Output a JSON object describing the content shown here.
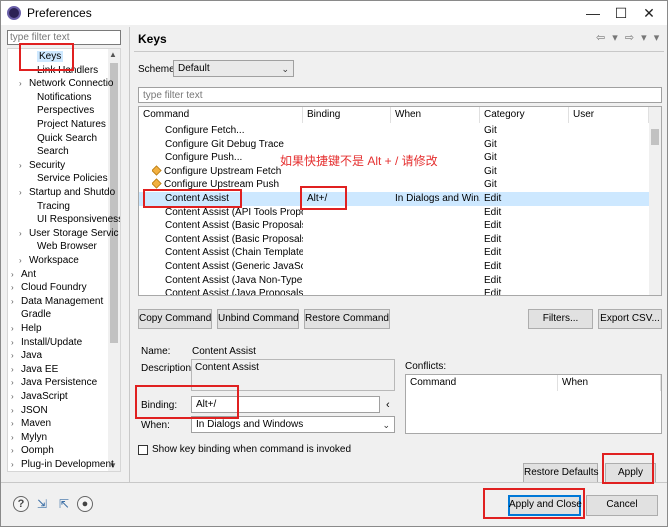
{
  "window": {
    "title": "Preferences",
    "minimize": "—",
    "maximize": "☐",
    "close": "✕"
  },
  "sidebar": {
    "filter_placeholder": "type filter text",
    "items": [
      {
        "label": "Keys",
        "indent": 2,
        "arrow": "",
        "selected": true
      },
      {
        "label": "Link Handlers",
        "indent": 2,
        "arrow": ""
      },
      {
        "label": "Network Connectio",
        "indent": 1,
        "arrow": "›"
      },
      {
        "label": "Notifications",
        "indent": 2,
        "arrow": ""
      },
      {
        "label": "Perspectives",
        "indent": 2,
        "arrow": ""
      },
      {
        "label": "Project Natures",
        "indent": 2,
        "arrow": ""
      },
      {
        "label": "Quick Search",
        "indent": 2,
        "arrow": ""
      },
      {
        "label": "Search",
        "indent": 2,
        "arrow": ""
      },
      {
        "label": "Security",
        "indent": 1,
        "arrow": "›"
      },
      {
        "label": "Service Policies",
        "indent": 2,
        "arrow": ""
      },
      {
        "label": "Startup and Shutdo",
        "indent": 1,
        "arrow": "›"
      },
      {
        "label": "Tracing",
        "indent": 2,
        "arrow": ""
      },
      {
        "label": "UI Responsiveness",
        "indent": 2,
        "arrow": ""
      },
      {
        "label": "User Storage Servic",
        "indent": 1,
        "arrow": "›"
      },
      {
        "label": "Web Browser",
        "indent": 2,
        "arrow": ""
      },
      {
        "label": "Workspace",
        "indent": 1,
        "arrow": "›"
      },
      {
        "label": "Ant",
        "indent": 0,
        "arrow": "›"
      },
      {
        "label": "Cloud Foundry",
        "indent": 0,
        "arrow": "›"
      },
      {
        "label": "Data Management",
        "indent": 0,
        "arrow": "›"
      },
      {
        "label": "Gradle",
        "indent": 0,
        "arrow": ""
      },
      {
        "label": "Help",
        "indent": 0,
        "arrow": "›"
      },
      {
        "label": "Install/Update",
        "indent": 0,
        "arrow": "›"
      },
      {
        "label": "Java",
        "indent": 0,
        "arrow": "›"
      },
      {
        "label": "Java EE",
        "indent": 0,
        "arrow": "›"
      },
      {
        "label": "Java Persistence",
        "indent": 0,
        "arrow": "›"
      },
      {
        "label": "JavaScript",
        "indent": 0,
        "arrow": "›"
      },
      {
        "label": "JSON",
        "indent": 0,
        "arrow": "›"
      },
      {
        "label": "Maven",
        "indent": 0,
        "arrow": "›"
      },
      {
        "label": "Mylyn",
        "indent": 0,
        "arrow": "›"
      },
      {
        "label": "Oomph",
        "indent": 0,
        "arrow": "›"
      },
      {
        "label": "Plug-in Development",
        "indent": 0,
        "arrow": "›"
      }
    ]
  },
  "page": {
    "title": "Keys",
    "nav": "⇦ ▾ ⇨ ▾ ▾",
    "scheme_label": "Scheme:",
    "scheme_value": "Default",
    "filter_placeholder": "type filter text",
    "columns": [
      "Command",
      "Binding",
      "When",
      "Category",
      "User"
    ],
    "rows": [
      {
        "command": "Configure Fetch...",
        "binding": "",
        "when": "",
        "category": "Git",
        "icon": false
      },
      {
        "command": "Configure Git Debug Trace",
        "binding": "",
        "when": "",
        "category": "Git",
        "icon": false
      },
      {
        "command": "Configure Push...",
        "binding": "",
        "when": "",
        "category": "Git",
        "icon": false
      },
      {
        "command": "Configure Upstream Fetch",
        "binding": "",
        "when": "",
        "category": "Git",
        "icon": true
      },
      {
        "command": "Configure Upstream Push",
        "binding": "",
        "when": "",
        "category": "Git",
        "icon": true
      },
      {
        "command": "Content Assist",
        "binding": "Alt+/",
        "when": "In Dialogs and Win...",
        "category": "Edit",
        "icon": false,
        "selected": true
      },
      {
        "command": "Content Assist (API Tools Proposal",
        "binding": "",
        "when": "",
        "category": "Edit",
        "icon": false
      },
      {
        "command": "Content Assist (Basic Proposals)",
        "binding": "",
        "when": "",
        "category": "Edit",
        "icon": false
      },
      {
        "command": "Content Assist (Basic Proposals)",
        "binding": "",
        "when": "",
        "category": "Edit",
        "icon": false
      },
      {
        "command": "Content Assist (Chain Template Pro",
        "binding": "",
        "when": "",
        "category": "Edit",
        "icon": false
      },
      {
        "command": "Content Assist (Generic JavaScript",
        "binding": "",
        "when": "",
        "category": "Edit",
        "icon": false
      },
      {
        "command": "Content Assist (Java Non-Type Pro",
        "binding": "",
        "when": "",
        "category": "Edit",
        "icon": false
      },
      {
        "command": "Content Assist (Java Proposals (Ta",
        "binding": "",
        "when": "",
        "category": "Edit",
        "icon": false
      }
    ],
    "annotation": "如果快捷键不是 Alt + / 请修改",
    "buttons": {
      "copy": "Copy Command",
      "unbind": "Unbind Command",
      "restore_command": "Restore Command",
      "filters": "Filters...",
      "export": "Export CSV..."
    },
    "name_label": "Name:",
    "name_value": "Content Assist",
    "description_label": "Description:",
    "description_value": "Content Assist",
    "conflicts_label": "Conflicts:",
    "conflicts_columns": [
      "Command",
      "When"
    ],
    "binding_label": "Binding:",
    "binding_value": "Alt+/",
    "binding_arrow": "‹",
    "when_label": "When:",
    "when_value": "In Dialogs and Windows",
    "checkbox_label": "Show key binding when command is invoked",
    "restore_defaults": "Restore Defaults",
    "apply": "Apply"
  },
  "footer": {
    "help_icon": "?",
    "apply_close": "Apply and Close",
    "cancel": "Cancel"
  },
  "colors": {
    "highlight": "#cde8ff",
    "annotation": "#e53030",
    "default_button_border": "#0078d7"
  }
}
